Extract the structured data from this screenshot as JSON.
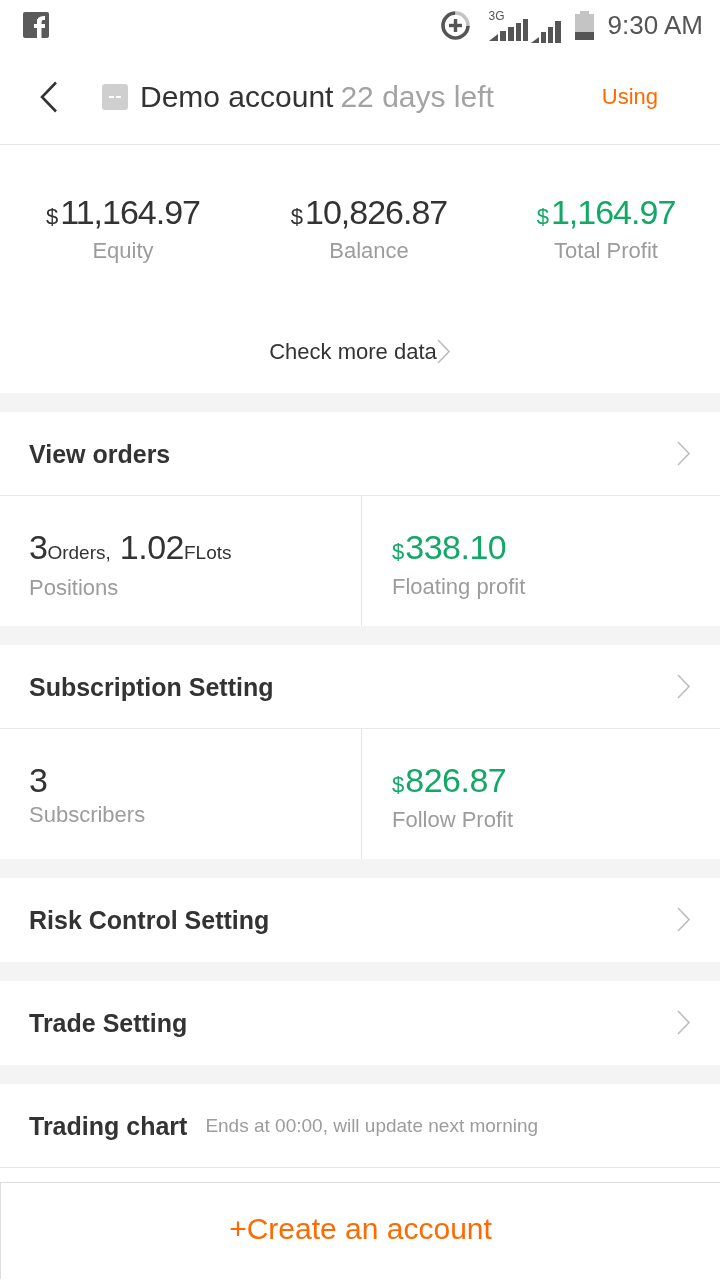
{
  "status_bar": {
    "network": "3G",
    "time": "9:30 AM"
  },
  "header": {
    "title": "Demo account",
    "days_left": "22 days left",
    "status": "Using"
  },
  "summary": {
    "stats": [
      {
        "currency": "$",
        "value": "11,164.97",
        "label": "Equity",
        "kind": "plain"
      },
      {
        "currency": "$",
        "value": "10,826.87",
        "label": "Balance",
        "kind": "plain"
      },
      {
        "currency": "$",
        "value": "1,164.97",
        "label": "Total Profit",
        "kind": "profit"
      }
    ],
    "more_link": "Check more data"
  },
  "sections": [
    {
      "kind": "link",
      "title": "View orders",
      "metrics": [
        {
          "kind": "plain",
          "values": [
            {
              "parts": [
                {
                  "text": "3",
                  "kind": "number"
                },
                {
                  "text": "Orders,",
                  "kind": "unit"
                }
              ]
            },
            {
              "parts": [
                {
                  "text": "1.02",
                  "kind": "number"
                },
                {
                  "text": "FLots",
                  "kind": "unit"
                }
              ]
            }
          ],
          "label": "Positions"
        },
        {
          "kind": "profit",
          "values": [
            {
              "parts": [
                {
                  "text": "$",
                  "kind": "currency"
                },
                {
                  "text": "338.10",
                  "kind": "number"
                }
              ]
            }
          ],
          "label": "Floating profit"
        }
      ]
    },
    {
      "kind": "link",
      "title": "Subscription Setting",
      "metrics": [
        {
          "kind": "plain",
          "values": [
            {
              "parts": [
                {
                  "text": "3",
                  "kind": "number"
                }
              ]
            }
          ],
          "label": "Subscribers"
        },
        {
          "kind": "profit",
          "values": [
            {
              "parts": [
                {
                  "text": "$",
                  "kind": "currency"
                },
                {
                  "text": "826.87",
                  "kind": "number"
                }
              ]
            }
          ],
          "label": "Follow Profit"
        }
      ]
    },
    {
      "kind": "link",
      "title": "Risk Control Setting"
    },
    {
      "kind": "link",
      "title": "Trade Setting"
    },
    {
      "kind": "info",
      "title": "Trading chart",
      "note": "Ends at 00:00, will update next morning"
    }
  ],
  "create_button": {
    "label": "+Create an account"
  }
}
